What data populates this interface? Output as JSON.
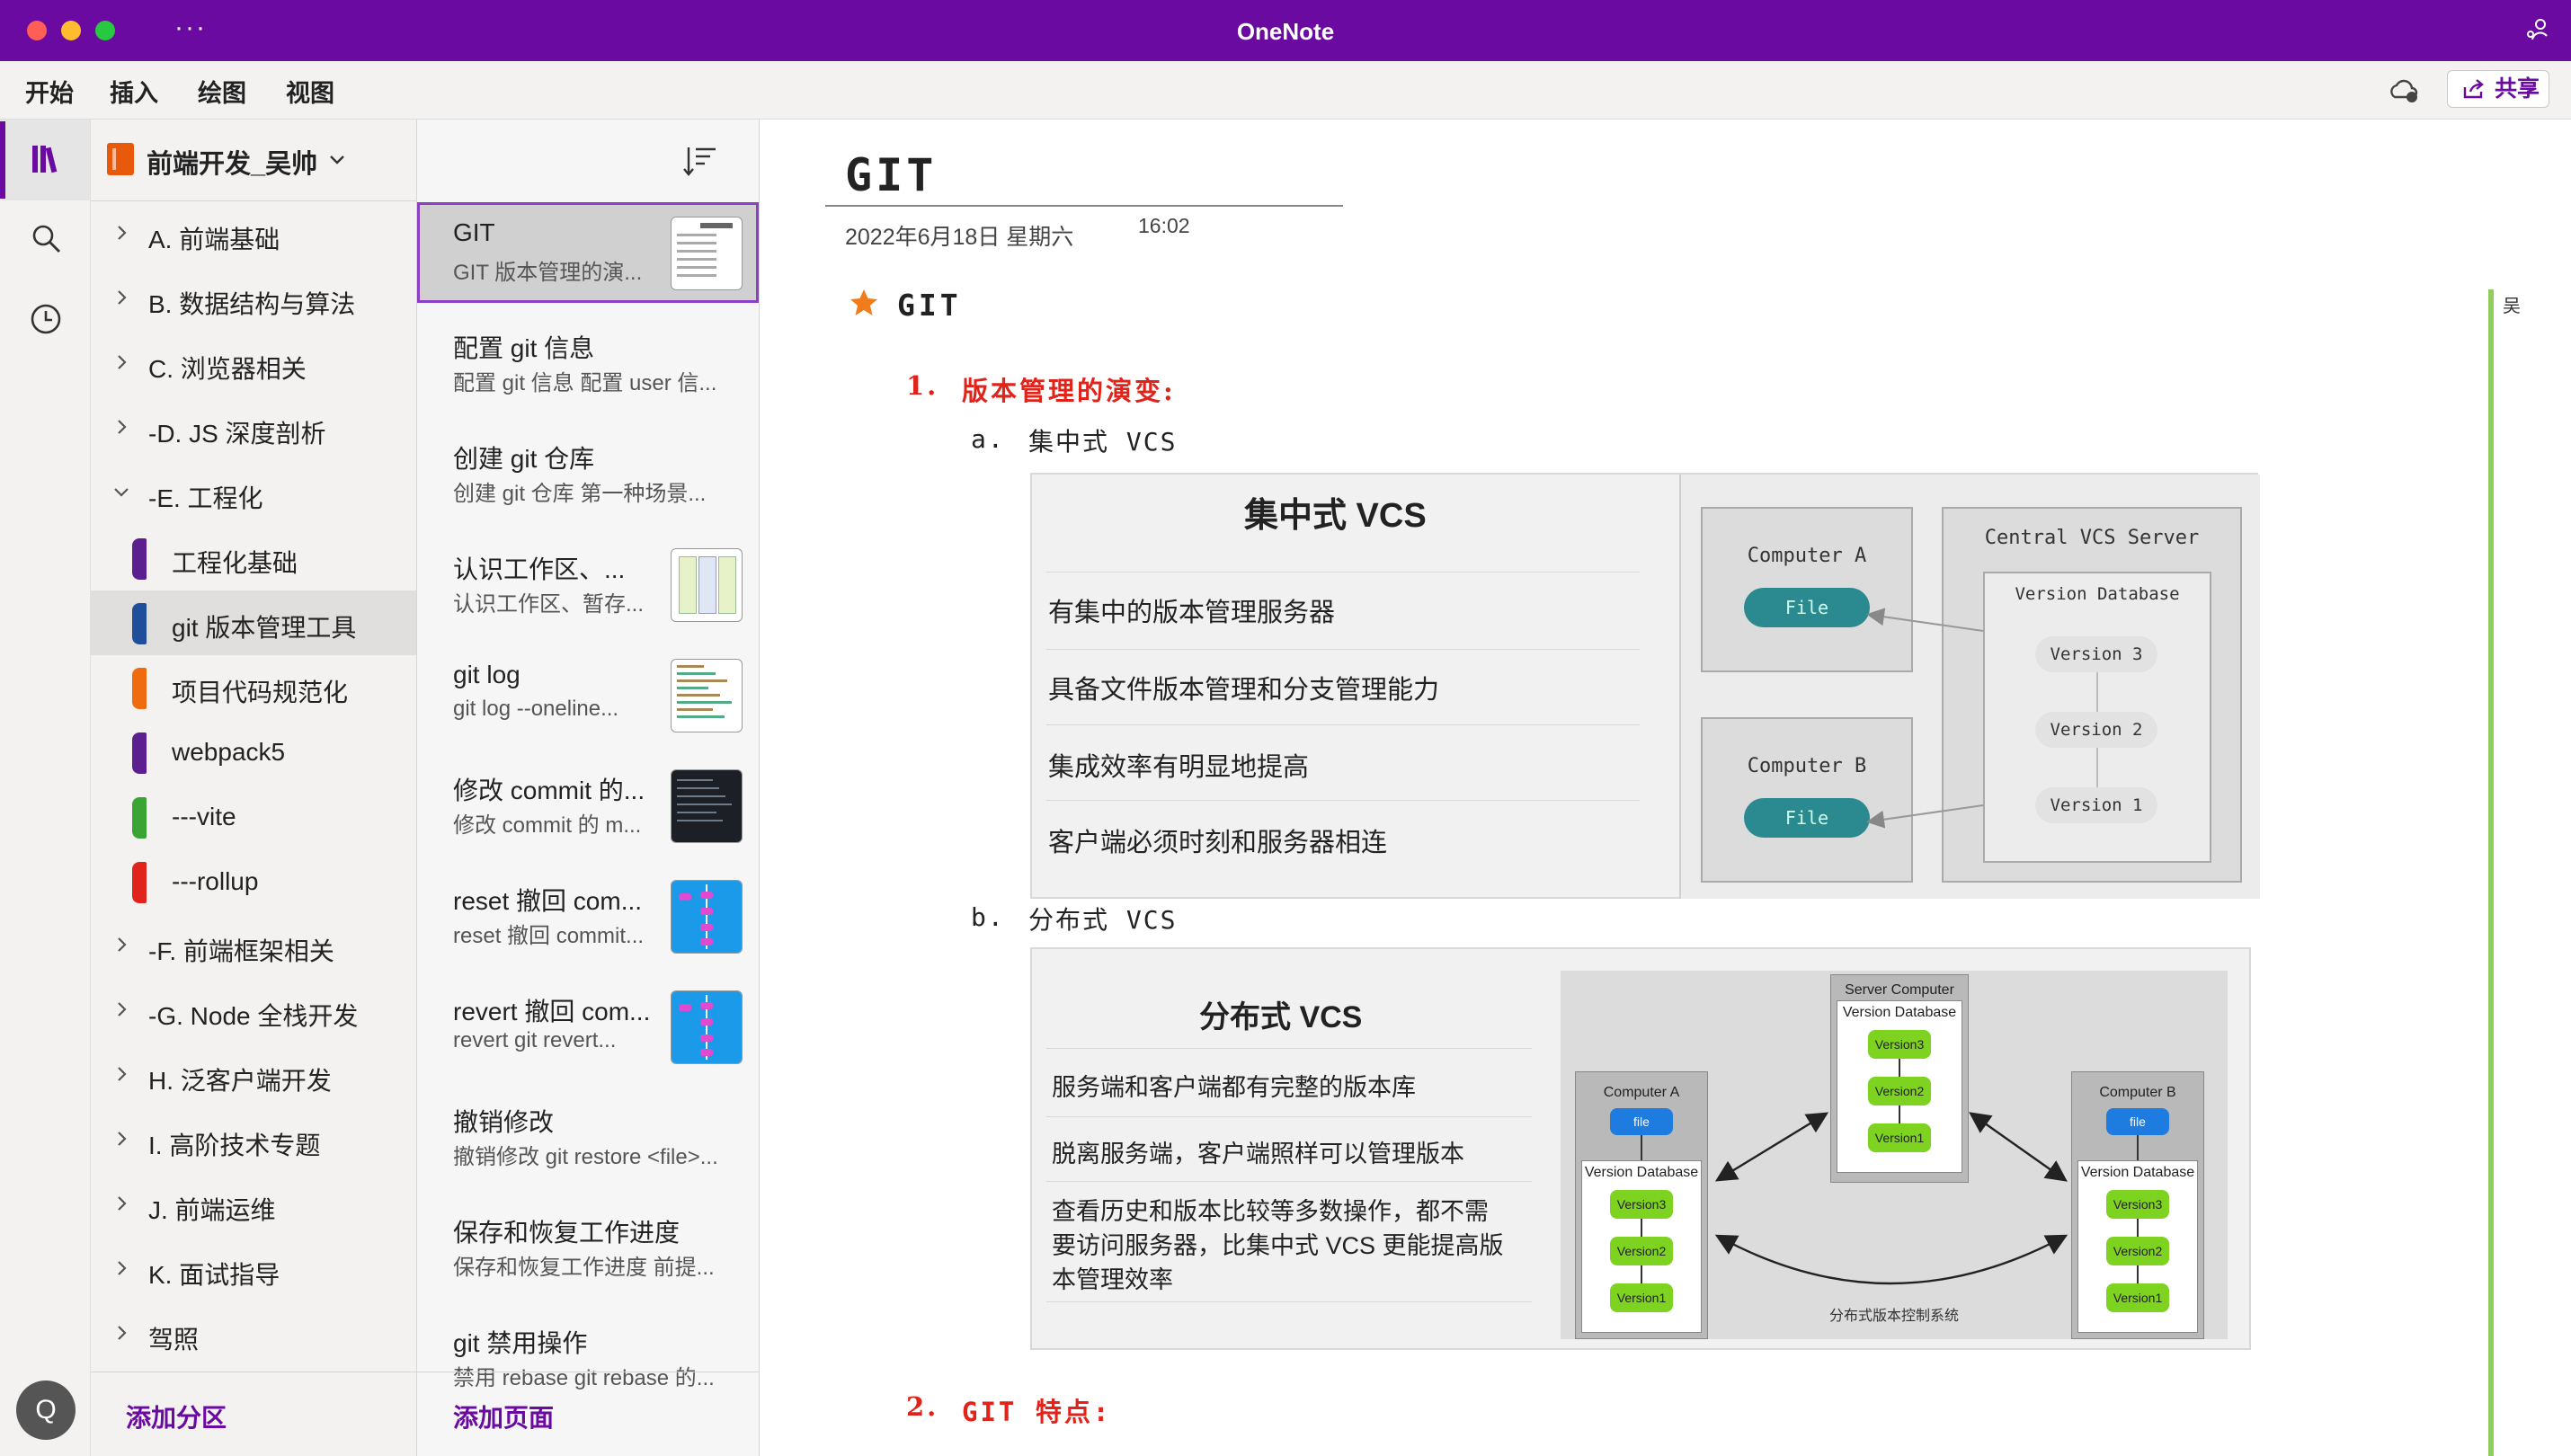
{
  "app": {
    "title": "OneNote"
  },
  "menu": {
    "items": [
      "开始",
      "插入",
      "绘图",
      "视图"
    ],
    "share": "共享"
  },
  "notebook": {
    "name": "前端开发_吴帅"
  },
  "user": {
    "initial": "Q"
  },
  "sections": [
    {
      "label": "A. 前端基础",
      "expanded": false
    },
    {
      "label": "B. 数据结构与算法",
      "expanded": false
    },
    {
      "label": "C. 浏览器相关",
      "expanded": false
    },
    {
      "label": "-D. JS 深度剖析",
      "expanded": false
    },
    {
      "label": "-E. 工程化",
      "expanded": true
    },
    {
      "label": "工程化基础",
      "color": "#5b1f8f",
      "sub": true
    },
    {
      "label": "git 版本管理工具",
      "color": "#1f4f9a",
      "sub": true,
      "selected": true
    },
    {
      "label": "项目代码规范化",
      "color": "#f06a0f",
      "sub": true
    },
    {
      "label": "webpack5",
      "color": "#5b1f8f",
      "sub": true
    },
    {
      "label": "---vite",
      "color": "#3aa535",
      "sub": true
    },
    {
      "label": "---rollup",
      "color": "#e0241b",
      "sub": true
    },
    {
      "label": "-F. 前端框架相关",
      "expanded": false
    },
    {
      "label": "-G. Node 全栈开发",
      "expanded": false
    },
    {
      "label": "H. 泛客户端开发",
      "expanded": false
    },
    {
      "label": "I. 高阶技术专题",
      "expanded": false
    },
    {
      "label": "J. 前端运维",
      "expanded": false
    },
    {
      "label": "K. 面试指导",
      "expanded": false
    },
    {
      "label": "驾照",
      "expanded": false
    }
  ],
  "add_section": "添加分区",
  "add_page": "添加页面",
  "pages": [
    {
      "title": "GIT",
      "preview": "GIT  版本管理的演...",
      "thumb": "doc",
      "selected": true
    },
    {
      "title": "配置 git 信息",
      "preview": "配置 git 信息  配置 user 信..."
    },
    {
      "title": "创建 git 仓库",
      "preview": "创建 git 仓库   第一种场景..."
    },
    {
      "title": "认识工作区、...",
      "preview": "认识工作区、暂存...",
      "thumb": "diagram"
    },
    {
      "title": "git log",
      "preview": "git log  --oneline...",
      "thumb": "code"
    },
    {
      "title": "修改 commit 的...",
      "preview": "修改 commit 的 m...",
      "thumb": "dark"
    },
    {
      "title": "reset 撤回 com...",
      "preview": "reset 撤回 commit...",
      "thumb": "blue"
    },
    {
      "title": "revert 撤回 com...",
      "preview": "revert  git revert...",
      "thumb": "blue"
    },
    {
      "title": "撤销修改",
      "preview": "撤销修改  git restore <file>..."
    },
    {
      "title": "保存和恢复工作进度",
      "preview": "保存和恢复工作进度  前提..."
    },
    {
      "title": "git 禁用操作",
      "preview": "禁用 rebase  git rebase 的..."
    }
  ],
  "page": {
    "title": "GIT",
    "date": "2022年6月18日 星期六",
    "time": "16:02",
    "heading": "GIT",
    "h1_1_num": "1.",
    "h1_1": "版本管理的演变:",
    "a_label": "a.",
    "a_text": "集中式 VCS",
    "b_label": "b.",
    "b_text": "分布式 VCS",
    "h1_2_num": "2.",
    "h1_2": "GIT 特点:",
    "author": "吴"
  },
  "central_fig": {
    "title": "集中式 VCS",
    "rows": [
      "有集中的版本管理服务器",
      "具备文件版本管理和分支管理能力",
      "集成效率有明显地提高",
      "客户端必须时刻和服务器相连"
    ],
    "computer_a": "Computer A",
    "computer_b": "Computer B",
    "file": "File",
    "server": "Central VCS Server",
    "db": "Version Database",
    "versions": [
      "Version 3",
      "Version 2",
      "Version 1"
    ]
  },
  "dist_fig": {
    "title": "分布式 VCS",
    "rows": [
      "服务端和客户端都有完整的版本库",
      "脱离服务端，客户端照样可以管理版本",
      "查看历史和版本比较等多数操作，都不需",
      "要访问服务器，比集中式 VCS 更能提高版",
      "本管理效率"
    ],
    "server": "Server Computer",
    "comp_a": "Computer A",
    "comp_b": "Computer B",
    "db": "Version Database",
    "file": "file",
    "versions": [
      "Version3",
      "Version2",
      "Version1"
    ],
    "caption": "分布式版本控制系统"
  },
  "colors": {
    "accent": "#6b0aa0",
    "red": "#e0241b",
    "teal": "#2a8a8f",
    "green_node": "#7ed321",
    "blue_node": "#1e7be0"
  }
}
